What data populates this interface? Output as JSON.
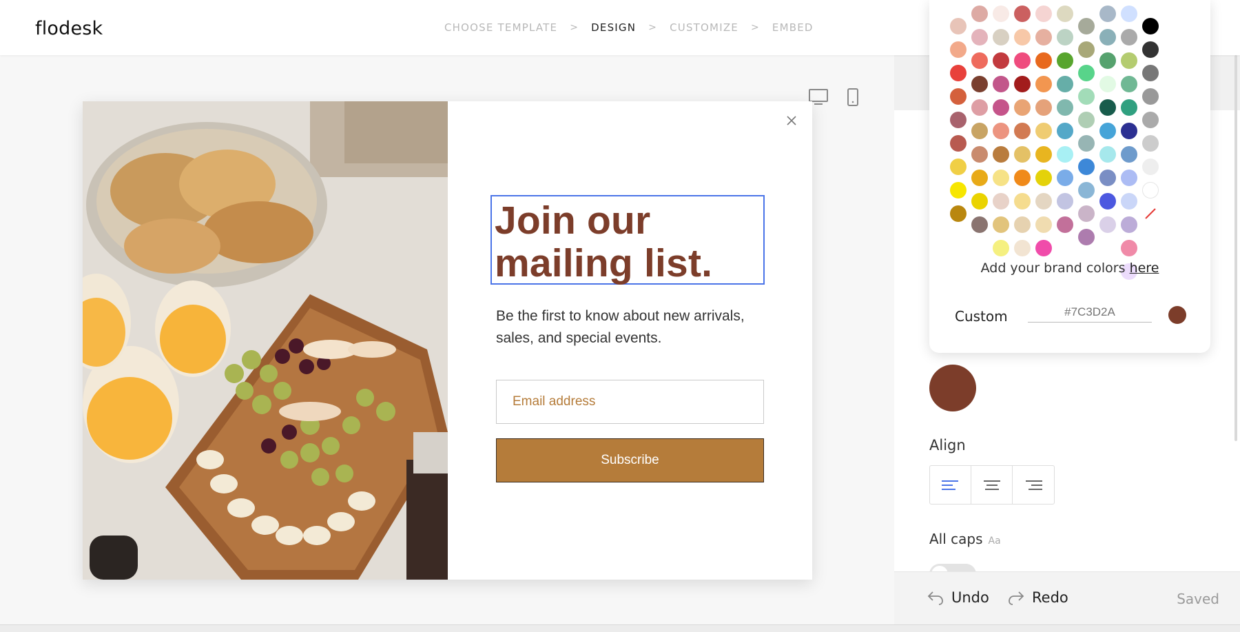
{
  "app": {
    "logo": "flodesk"
  },
  "steps": [
    {
      "label": "CHOOSE TEMPLATE",
      "active": false
    },
    {
      "label": "DESIGN",
      "active": true
    },
    {
      "label": "CUSTOMIZE",
      "active": false
    },
    {
      "label": "EMBED",
      "active": false
    }
  ],
  "step_separator": ">",
  "popup": {
    "headline_line1": "Join our",
    "headline_line2": "mailing list.",
    "subtext": "Be the first to know about new arrivals, sales, and special events.",
    "email_placeholder": "Email address",
    "subscribe_label": "Subscribe"
  },
  "picker": {
    "brand_text": "Add your brand colors",
    "brand_link": "here",
    "custom_label": "Custom",
    "custom_value": "#7C3D2A",
    "selected_color": "#7C3D2A",
    "columns": [
      [
        "#e8c4b8",
        "#f2a98a",
        "#e8413b",
        "#d4603c",
        "#a8626d",
        "#b85a50",
        "#f0cf46",
        "#f7e600",
        "#b9870f"
      ],
      [
        "#ddaaa4",
        "#e4b3bb",
        "#ee6b5d",
        "#7a3f2f",
        "#de9ea4",
        "#c8a464",
        "#c98b6e",
        "#e8aa18",
        "#ead300",
        "#8a7470"
      ],
      [
        "#f8eae6",
        "#d8d0c2",
        "#c23a3e",
        "#c2568a",
        "#c5548a",
        "#ec9480",
        "#b97c3e",
        "#f6e286",
        "#e8d2c8",
        "#e2c47c",
        "#f5f080"
      ],
      [
        "#cb6060",
        "#f7c8a8",
        "#ef4c7e",
        "#a21c1c",
        "#e9a474",
        "#d27a52",
        "#e4c166",
        "#f08a1a",
        "#f5dc8e",
        "#e6d2b0",
        "#f2e4d2"
      ],
      [
        "#f5d4d2",
        "#e6b0a0",
        "#e8691e",
        "#f29650",
        "#e5a27a",
        "#efcc72",
        "#e8b520",
        "#e4d20a",
        "#e4d6c2",
        "#f0dcb0",
        "#f04caa"
      ],
      [
        "#ddd9c0",
        "#bcd3c4",
        "#58a52e",
        "#66aea8",
        "#80b8ae",
        "#54a8c8",
        "#a8f0f4",
        "#7aace8",
        "#c2c4e2",
        "#c2709a"
      ],
      [
        "#a6aa9a",
        "#a8a878",
        "#58d48a",
        "#a2dcb8",
        "#afceb4",
        "#97b5b4",
        "#3d88d8",
        "#8ab6d6",
        "#cab4c8",
        "#ad7cae"
      ],
      [
        "#a8b8c8",
        "#8ab0b8",
        "#56a26e",
        "#e2fae4",
        "#185c4c",
        "#46a4d8",
        "#a6e8ec",
        "#7a8ec4",
        "#4c58e0",
        "#dad0e8"
      ],
      [
        "#d0e0ff",
        "#aaaaaa",
        "#b4cc70",
        "#70b894",
        "#30a080",
        "#2c3092",
        "#6e9bcc",
        "#acbcf4",
        "#cad6f8",
        "#bcacd8",
        "#f08aa8",
        "#ecdcfc"
      ],
      [
        "#000000",
        "#333333",
        "#777777",
        "#999999",
        "#aaaaaa",
        "#cccccc",
        "#eeeeee",
        "#ffffff",
        "none"
      ]
    ]
  },
  "panel": {
    "align_label": "Align",
    "allcaps_label": "All caps",
    "allcaps_hint": "Aa",
    "undo_label": "Undo",
    "redo_label": "Redo",
    "status": "Saved",
    "text_color": "#7C3D2A"
  },
  "colors": {
    "accent_blue": "#4a74e8",
    "brand_brown": "#7c3d2a",
    "button_gold": "#b57c3a"
  }
}
